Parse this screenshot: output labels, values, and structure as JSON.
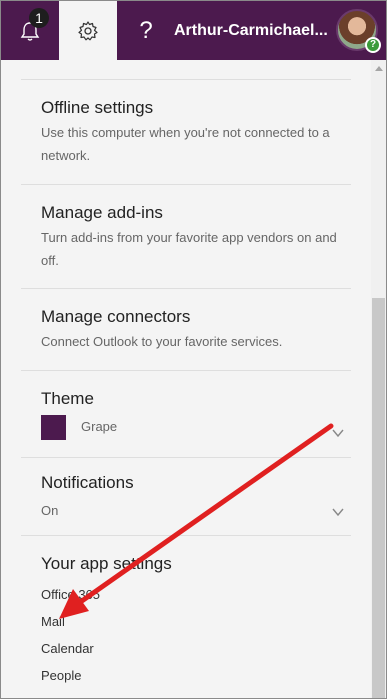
{
  "topbar": {
    "notification_count": "1",
    "help_label": "?",
    "user_name": "Arthur-Carmichael...",
    "presence_symbol": "?",
    "background_color": "#4c1a4e",
    "icons": [
      "bell-icon",
      "gear-icon",
      "help-icon",
      "avatar",
      "presence-icon"
    ]
  },
  "settings": {
    "offline": {
      "title": "Offline settings",
      "description": "Use this computer when you're not connected to a network."
    },
    "addins": {
      "title": "Manage add-ins",
      "description": "Turn add-ins from your favorite app vendors on and off."
    },
    "connectors": {
      "title": "Manage connectors",
      "description": "Connect Outlook to your favorite services."
    },
    "theme": {
      "title": "Theme",
      "value": "Grape",
      "swatch_color": "#4c1a4e"
    },
    "notifications": {
      "title": "Notifications",
      "value": "On"
    },
    "app_settings": {
      "title": "Your app settings",
      "links": [
        "Office 365",
        "Mail",
        "Calendar",
        "People"
      ]
    }
  },
  "annotation": {
    "arrow_color": "#e02020"
  }
}
